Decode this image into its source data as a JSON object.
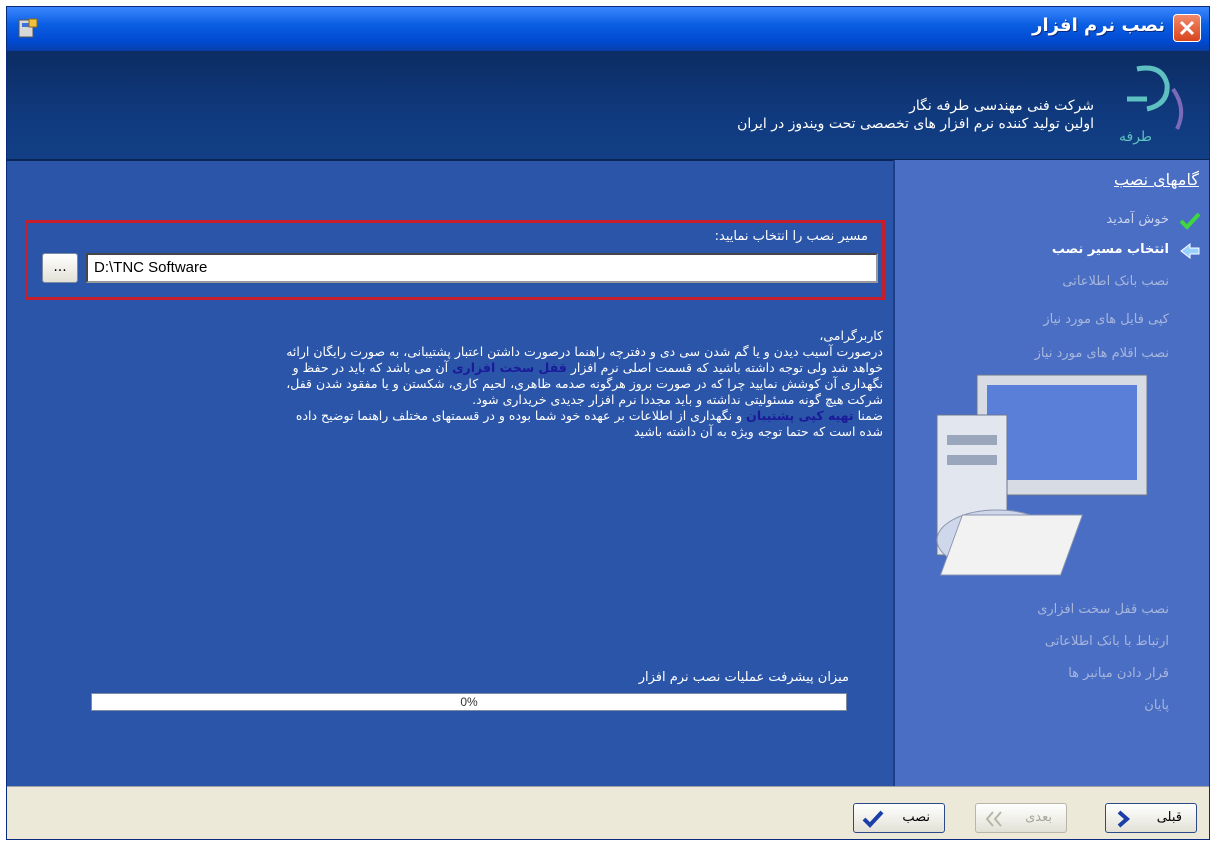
{
  "window": {
    "title": "نصب نرم افزار"
  },
  "header": {
    "company_line1": "شرکت فنی مهندسی طرفه نگار",
    "company_line2": "اولین تولید کننده نرم افزار های تخصصی تحت ویندوز در ایران"
  },
  "install": {
    "path_label": "مسیر نصب را انتخاب نمایید:",
    "browse_label": "...",
    "path_value": "D:\\TNC Software"
  },
  "notice": {
    "greeting": "کاربرگرامی،",
    "line1": "درصورت آسیب دیدن و یا گم شدن سی دی و دفترچه راهنما درصورت داشتن اعتبار پشتیبانی، به صورت رایگان ارائه",
    "line2_a": "خواهد شد ولی توجه داشته باشید که قسمت اصلی نرم افزار ",
    "line2_hl": "قفل سخت افزاری",
    "line2_b": " آن می باشد که باید در حفظ و",
    "line3": "نگهداری آن کوشش نمایید چرا که در صورت بروز هرگونه صدمه ظاهری، لحیم کاری، شکستن و یا مفقود شدن قفل،",
    "line4": "شرکت هیچ گونه مسئولیتی نداشته و باید مجددا نرم افزار جدیدی خریداری شود.",
    "line5_a": "ضمنا ",
    "line5_hl": "تهیه کپی پشتیبان",
    "line5_b": " و نگهداری از اطلاعات بر عهده خود شما بوده و در قسمتهای مختلف راهنما توضیح داده",
    "line6": "شده است که حتما توجه ویژه به آن داشته باشید"
  },
  "progress": {
    "label": "میزان پیشرفت عملیات نصب نرم افزار",
    "text": "0%",
    "value": 0
  },
  "sidebar": {
    "title": "گامهای نصب",
    "steps": [
      {
        "label": "خوش آمدید",
        "state": "done"
      },
      {
        "label": "انتخاب مسیر نصب",
        "state": "current"
      },
      {
        "label": "نصب بانک اطلاعاتی",
        "state": "pending"
      },
      {
        "label": "کپی فایل های مورد نیاز",
        "state": "pending"
      },
      {
        "label": "نصب اقلام های مورد نیاز",
        "state": "pending"
      },
      {
        "label": "نصب قفل سخت افزاری",
        "state": "pending"
      },
      {
        "label": "ارتباط با بانک اطلاعاتی",
        "state": "pending"
      },
      {
        "label": "قرار دادن میانبر ها",
        "state": "pending"
      },
      {
        "label": "پایان",
        "state": "pending"
      }
    ]
  },
  "footer": {
    "back_label": "قبلی",
    "next_label": "بعدی",
    "install_label": "نصب"
  },
  "colors": {
    "title_bar": "#0a5ee2",
    "body": "#2a55a8",
    "sidebar": "#4a6ec4",
    "highlight_border": "#c61e2a"
  }
}
